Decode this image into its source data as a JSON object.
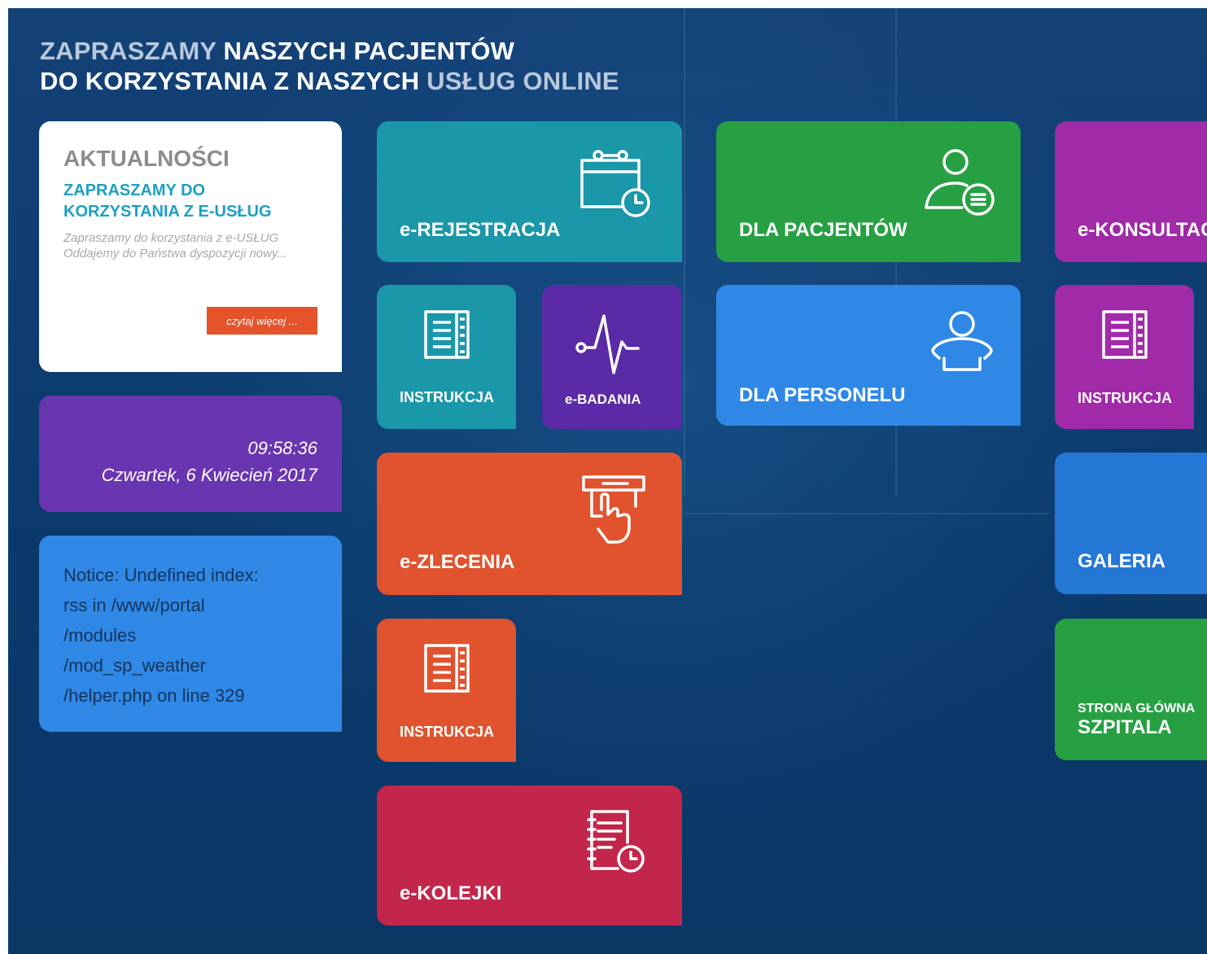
{
  "headline": {
    "line1_dim": "ZAPRASZAMY",
    "line1_bright": " NASZYCH PACJENTÓW",
    "line2_bright": "DO KORZYSTANIA Z NASZYCH ",
    "line2_dim": "USŁUG ONLINE"
  },
  "news": {
    "title": "AKTUALNOŚCI",
    "subtitle": "ZAPRASZAMY DO KORZYSTANIA Z E-USŁUG",
    "excerpt": "Zapraszamy do korzystania z e-USŁUG Oddajemy do Państwa dyspozycji nowy...",
    "more_label": "czytaj więcej ..."
  },
  "clock": {
    "time": "09:58:36",
    "date": "Czwartek, 6 Kwiecień 2017"
  },
  "notice": {
    "lines": [
      "Notice: Undefined index:",
      "rss in /www/portal",
      "/modules",
      "/mod_sp_weather",
      "/helper.php on line 329"
    ]
  },
  "tiles": {
    "e_rejestracja": {
      "label": "e-REJESTRACJA",
      "icon": "calendar-clock-icon",
      "color": "#1a97a8"
    },
    "instrukcja_1": {
      "label": "INSTRUKCJA",
      "icon": "document-list-icon",
      "color": "#1a97a8"
    },
    "e_badania": {
      "label": "e-BADANIA",
      "icon": "heartbeat-icon",
      "color": "#5b2aa6"
    },
    "e_zlecenia": {
      "label": "e-ZLECENIA",
      "icon": "card-payment-hand-icon",
      "color": "#e0532e"
    },
    "instrukcja_2": {
      "label": "INSTRUKCJA",
      "icon": "document-list-icon",
      "color": "#e0532e"
    },
    "e_kolejki": {
      "label": "e-KOLEJKI",
      "icon": "document-clock-icon",
      "color": "#c2264b"
    },
    "dla_pacjentow": {
      "label": "DLA PACJENTÓW",
      "icon": "user-list-icon",
      "color": "#26a043"
    },
    "dla_personelu": {
      "label": "DLA PERSONELU",
      "icon": "user-icon",
      "color": "#2f88e6"
    },
    "e_konsultacje": {
      "label": "e-KONSULTAC",
      "color": "#a02aa8"
    },
    "instrukcja_3": {
      "label": "INSTRUKCJA",
      "icon": "document-list-icon",
      "color": "#a02aa8"
    },
    "galeria": {
      "label": "GALERIA",
      "color": "#2577d6"
    },
    "strona_glowna": {
      "label_line1": "STRONA GŁÓWNA",
      "label_line2": "SZPITALA",
      "color": "#26a043"
    }
  }
}
